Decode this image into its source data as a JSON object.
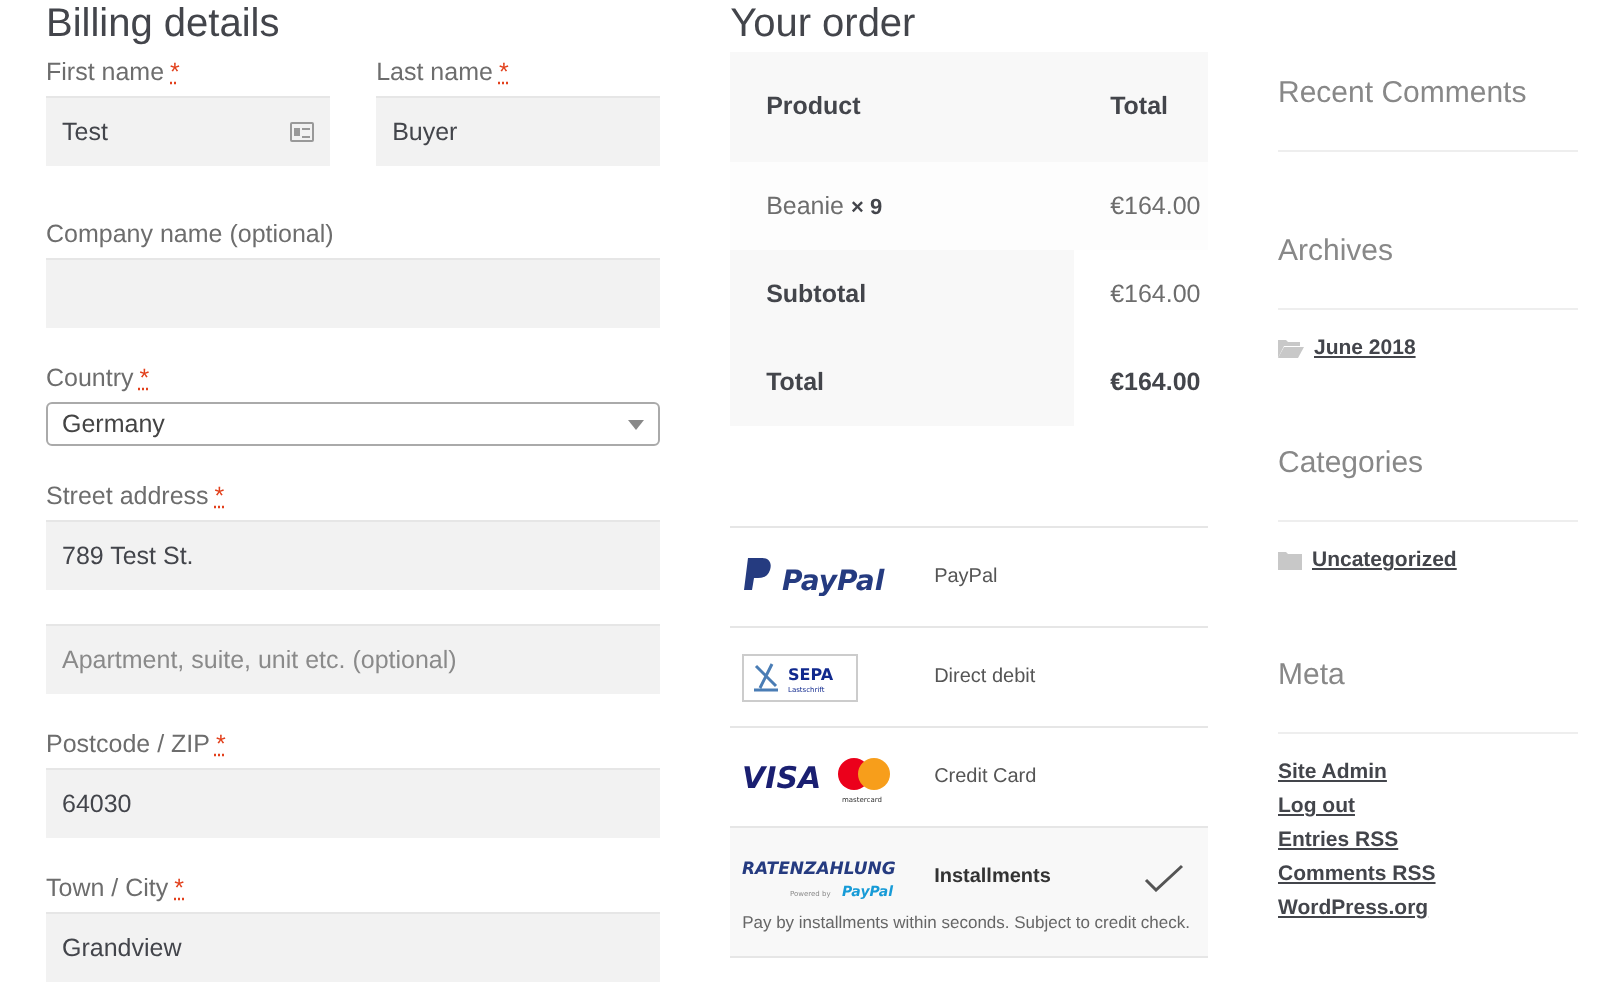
{
  "billing": {
    "title": "Billing details",
    "fields": [
      {
        "label": "First name",
        "required": "*",
        "value": "Test",
        "autofill_icon": true,
        "kind": "text",
        "half": true
      },
      {
        "label": "Last name",
        "required": "*",
        "value": "Buyer",
        "kind": "text",
        "half": true
      },
      {
        "label": "Company name (optional)",
        "kind": "text"
      },
      {
        "label": "Country",
        "required": "*",
        "value": "Germany",
        "kind": "select"
      },
      {
        "label": "Street address",
        "required": "*",
        "value": "789 Test St.",
        "kind": "text"
      },
      {
        "placeholder": "Apartment, suite, unit etc. (optional)",
        "kind": "text"
      },
      {
        "label": "Postcode / ZIP",
        "required": "*",
        "value": "64030",
        "kind": "text"
      },
      {
        "label": "Town / City",
        "required": "*",
        "value": "Grandview",
        "kind": "text"
      }
    ]
  },
  "order": {
    "title": "Your order",
    "columns": [
      "Product",
      "Total"
    ],
    "items": [
      {
        "name": "Beanie",
        "qty": "× 9",
        "total": "€164.00"
      }
    ],
    "totals": [
      {
        "label": "Subtotal",
        "value": "€164.00",
        "bold": false
      },
      {
        "label": "Total",
        "value": "€164.00",
        "bold": true
      }
    ]
  },
  "payment_methods": [
    {
      "logo": {
        "kind": "paypal",
        "texts": [
          "PayPal"
        ]
      },
      "name": "PayPal",
      "selected": false
    },
    {
      "logo": {
        "kind": "sepa",
        "texts": [
          "SEPA",
          "Lastschrift"
        ]
      },
      "name": "Direct debit",
      "selected": false
    },
    {
      "logo": {
        "kind": "cards",
        "texts": [
          "VISA",
          "mastercard"
        ]
      },
      "name": "Credit Card",
      "selected": false
    },
    {
      "logo": {
        "kind": "ratenzahlung",
        "texts": [
          "RATENZAHLUNG",
          "Powered by",
          "PayPal"
        ]
      },
      "name": "Installments",
      "selected": true,
      "description": "Pay by installments within seconds. Subject to credit check."
    }
  ],
  "sidebar": [
    {
      "title": "Recent Comments"
    },
    {
      "title": "Archives",
      "kind": "folder-open",
      "links": [
        "June 2018"
      ]
    },
    {
      "title": "Categories",
      "kind": "folder",
      "links": [
        "Uncategorized"
      ]
    },
    {
      "title": "Meta",
      "kind": "plain",
      "links": [
        "Site Admin",
        "Log out",
        "Entries RSS",
        "Comments RSS",
        "WordPress.org"
      ]
    }
  ]
}
